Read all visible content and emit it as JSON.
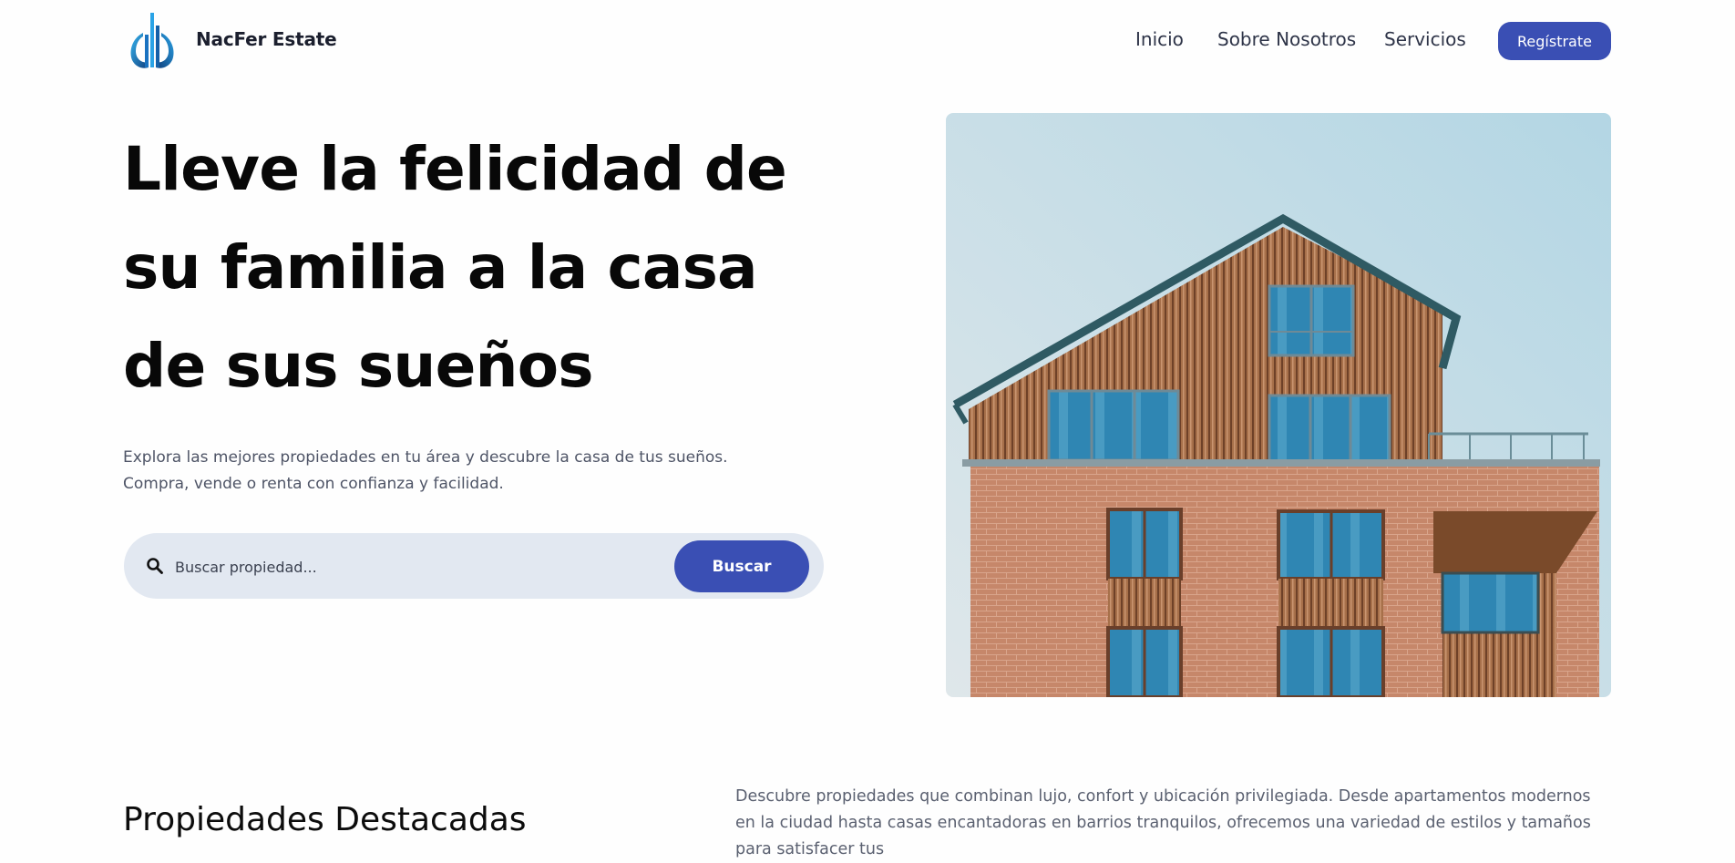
{
  "header": {
    "brand": "NacFer Estate",
    "nav": [
      "Inicio",
      "Sobre Nosotros",
      "Servicios"
    ],
    "register_label": "Regístrate"
  },
  "hero": {
    "title_lines": [
      "Lleve la felicidad de",
      "su familia a la casa",
      "de sus sueños"
    ],
    "description": "Explora las mejores propiedades en tu área y descubre la casa de tus sueños. Compra, vende o renta con confianza y facilidad.",
    "search": {
      "placeholder": "Buscar propiedad...",
      "button_label": "Buscar"
    }
  },
  "featured": {
    "title": "Propiedades Destacadas",
    "description": "Descubre propiedades que combinan lujo, confort y ubicación privilegiada. Desde apartamentos modernos en la ciudad hasta casas encantadoras en barrios tranquilos, ofrecemos una variedad de estilos y tamaños para satisfacer tus"
  },
  "colors": {
    "primary": "#3a4fb4",
    "search_bg": "#e2e8f1",
    "logo_blue": "#1f8fd9"
  },
  "icons": [
    "logo-icon",
    "search-icon"
  ]
}
